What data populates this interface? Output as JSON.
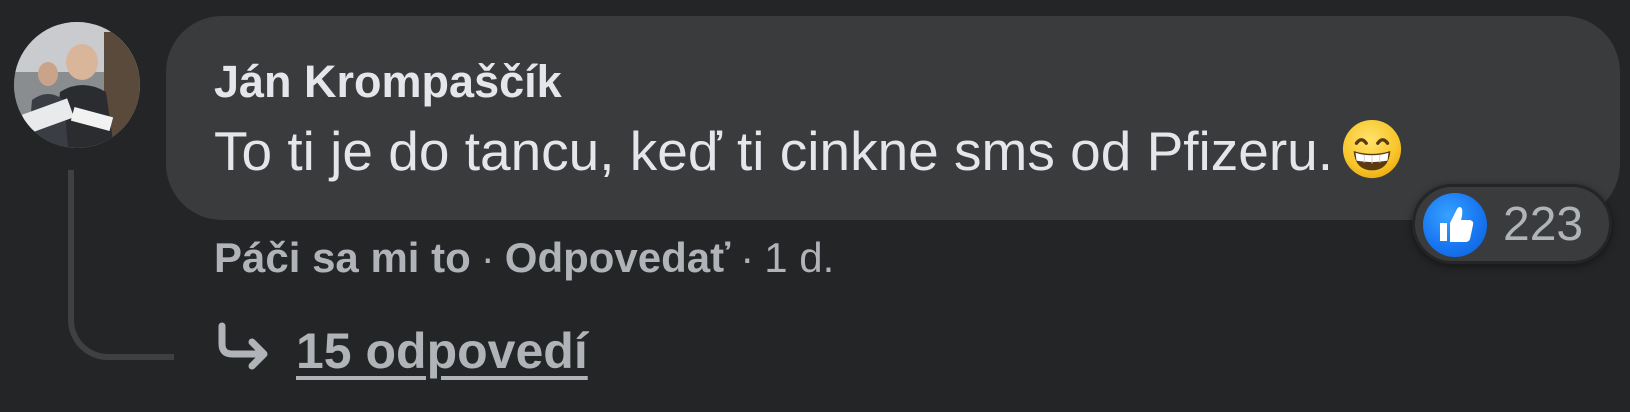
{
  "comment": {
    "author": "Ján Krompaščík",
    "text": "To ti je do tancu, keď ti cinkne sms od Pfizeru.",
    "emoji_icon": "grinning-face-with-smiling-eyes-icon",
    "avatar_icon": "profile-photo",
    "reactions": {
      "icon": "like-icon",
      "count": "223",
      "color": "#1877f2"
    },
    "actions": {
      "like_label": "Páči sa mi to",
      "separator": "·",
      "reply_label": "Odpovedať",
      "timestamp": "1 d."
    },
    "replies": {
      "icon": "reply-arrow-icon",
      "label": "15 odpovedí"
    }
  },
  "colors": {
    "background": "#242526",
    "bubble": "#3a3b3c",
    "primary_text": "#e4e6eb",
    "secondary_text": "#b0b3b8",
    "thread_line": "#3e4042"
  }
}
